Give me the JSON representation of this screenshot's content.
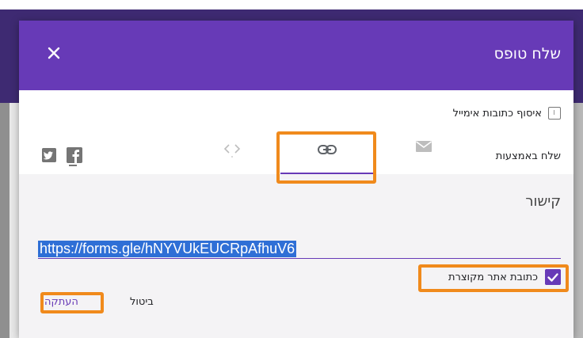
{
  "dialog": {
    "title": "שלח טופס",
    "close_icon": "close-icon",
    "collect_emails_label": "איסוף כתובות אימייל",
    "send_via_label": "שלח באמצעות",
    "tabs": [
      {
        "icon": "email-icon"
      },
      {
        "icon": "link-icon",
        "selected": true
      },
      {
        "icon": "embed-icon"
      }
    ],
    "social": [
      {
        "icon": "facebook-icon"
      },
      {
        "icon": "twitter-icon"
      }
    ],
    "link_section": {
      "title": "קישור",
      "url": "https://forms.gle/hNYVUkEUCRpAfhuV6",
      "shorten_label": "כתובת אתר מקוצרת",
      "shorten_checked": true,
      "cancel_label": "ביטול",
      "copy_label": "העתקה"
    }
  },
  "colors": {
    "accent": "#673ab7",
    "highlight": "#f08a1c"
  }
}
